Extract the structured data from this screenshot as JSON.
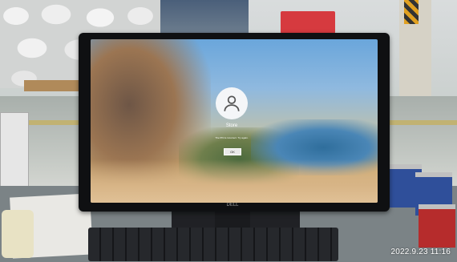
{
  "login_screen": {
    "username": "Store",
    "message": "The PIN is incorrect. Try again.",
    "ok_button": "OK",
    "icons": {
      "avatar": "user-icon"
    }
  },
  "monitor": {
    "brand": "DELL"
  },
  "photo_overlay": {
    "timestamp": "2022.9.23 11:16"
  },
  "colors": {
    "screen_sky": "#6aa6db",
    "login_text": "#ffffff",
    "monitor_bezel": "#0f1012"
  }
}
